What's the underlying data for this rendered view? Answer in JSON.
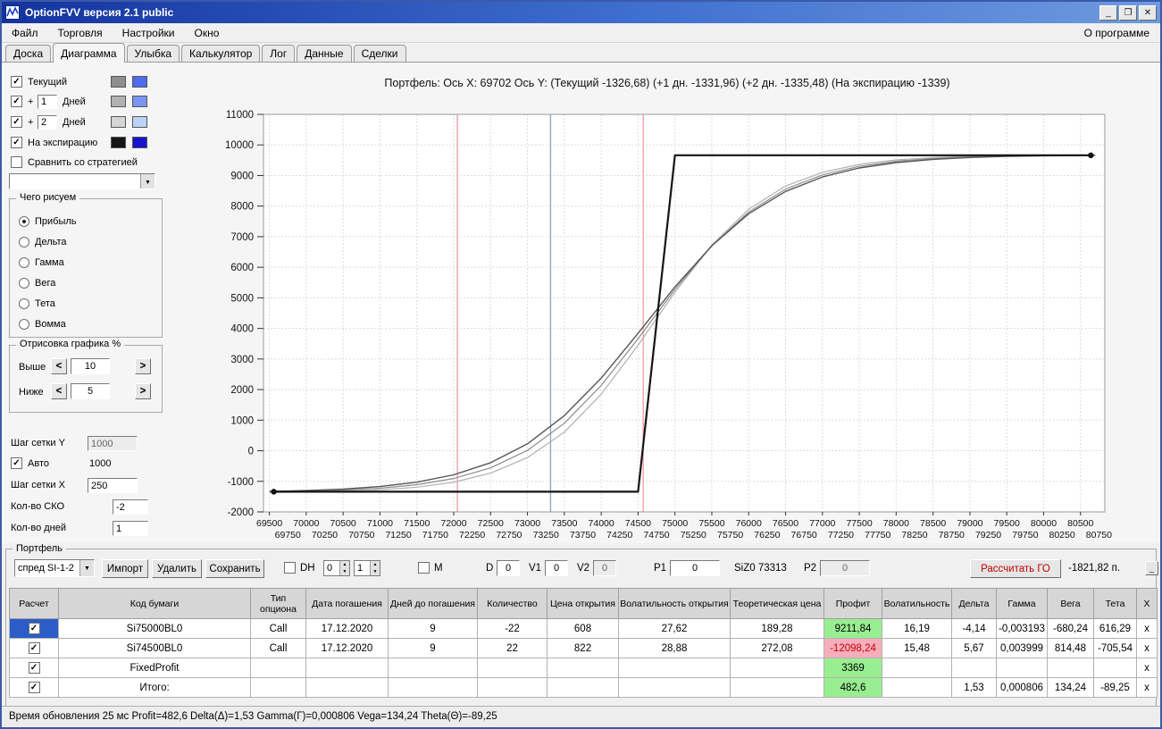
{
  "window": {
    "title": "OptionFVV версия 2.1 public",
    "controls": {
      "minimize": "_",
      "maximize": "❐",
      "close": "✕"
    }
  },
  "menu": {
    "items": [
      "Файл",
      "Торговля",
      "Настройки",
      "Окно"
    ],
    "right_item": "О программе"
  },
  "tabs": {
    "items": [
      "Доска",
      "Диаграмма",
      "Улыбка",
      "Калькулятор",
      "Лог",
      "Данные",
      "Сделки"
    ],
    "active": "Диаграмма"
  },
  "sidebar": {
    "toggles": [
      {
        "label": "Текущий",
        "checked": true,
        "colors": [
          "#8e8e8e",
          "#4f6bee"
        ]
      },
      {
        "prefix": "+",
        "value": "1",
        "label": "Дней",
        "checked": true,
        "colors": [
          "#b2b2b2",
          "#7b96f2"
        ]
      },
      {
        "prefix": "+",
        "value": "2",
        "label": "Дней",
        "checked": true,
        "colors": [
          "#d5d5d5",
          "#b9d2f8"
        ]
      },
      {
        "label": "На экспирацию",
        "checked": true,
        "colors": [
          "#151515",
          "#1515cd"
        ]
      }
    ],
    "compare": {
      "label": "Сравнить со стратегией",
      "checked": false
    },
    "strategy_select_value": "",
    "draw_group": {
      "title": "Чего рисуем",
      "options": [
        "Прибыль",
        "Дельта",
        "Гамма",
        "Вега",
        "Тета",
        "Вомма"
      ],
      "selected": "Прибыль"
    },
    "render_group": {
      "title": "Отрисовка графика %",
      "rows": [
        {
          "label": "Выше",
          "value": "10"
        },
        {
          "label": "Ниже",
          "value": "5"
        }
      ]
    },
    "fields": {
      "grid_y_label": "Шаг сетки Y",
      "grid_y_value": "1000",
      "auto_label": "Авто",
      "auto_checked": true,
      "auto_value": "1000",
      "grid_x_label": "Шаг сетки X",
      "grid_x_value": "250",
      "sko_label": "Кол-во СКО",
      "sko_value": "-2",
      "days_label": "Кол-во дней",
      "days_value": "1"
    }
  },
  "chart": {
    "title": "Портфель: Ось X: 69702 Ось Y:  (Текущий -1326,68)  (+1 дн. -1331,96)  (+2 дн. -1335,48)  (На экспирацию -1339)"
  },
  "chart_data": {
    "type": "line",
    "title": "Портфель: Ось X: 69702 Ось Y: (Текущий -1326,68) (+1 дн. -1331,96) (+2 дн. -1335,48) (На экспирацию -1339)",
    "xlabel": "",
    "ylabel": "",
    "x_range": [
      69420,
      80830
    ],
    "y_range": [
      -2000,
      11000
    ],
    "grid": true,
    "legend_position": "none",
    "y_ticks": [
      11000,
      10000,
      9000,
      8000,
      7000,
      6000,
      5000,
      4000,
      3000,
      2000,
      1000,
      0,
      -1000,
      -2000
    ],
    "x_ticks_upper": [
      69500,
      70000,
      70500,
      71000,
      71500,
      72000,
      72500,
      73000,
      73500,
      74000,
      74500,
      75000,
      75500,
      76000,
      76500,
      77000,
      77500,
      78000,
      78500,
      79000,
      79500,
      80000,
      80500
    ],
    "x_ticks_lower": [
      69750,
      70250,
      70750,
      71250,
      71750,
      72250,
      72750,
      73250,
      73750,
      74250,
      74750,
      75250,
      75750,
      76250,
      76750,
      77250,
      77750,
      78250,
      78750,
      79250,
      79750,
      80250,
      80750
    ],
    "vlines": [
      {
        "x": 72050,
        "color": "#f2a0ae",
        "meaning": "-2 СКО"
      },
      {
        "x": 73313,
        "color": "#96a5b6",
        "meaning": "SiZ0 73313"
      },
      {
        "x": 74570,
        "color": "#f2a0ae",
        "meaning": "+2 СКО"
      }
    ],
    "series": [
      {
        "name": "+2 дня",
        "color": "#b0b0b0",
        "width": 1.2,
        "points": [
          [
            69500,
            -1364
          ],
          [
            70000,
            -1350
          ],
          [
            70500,
            -1325
          ],
          [
            71000,
            -1278
          ],
          [
            71500,
            -1190
          ],
          [
            72000,
            -1029
          ],
          [
            72500,
            -733
          ],
          [
            73000,
            -225
          ],
          [
            73500,
            605
          ],
          [
            74000,
            1848
          ],
          [
            74500,
            3452
          ],
          [
            75000,
            5186
          ],
          [
            75500,
            6726
          ],
          [
            76000,
            7895
          ],
          [
            76500,
            8653
          ],
          [
            77000,
            9105
          ],
          [
            77500,
            9365
          ],
          [
            78000,
            9509
          ],
          [
            78500,
            9587
          ],
          [
            79000,
            9628
          ],
          [
            79500,
            9650
          ],
          [
            80000,
            9661
          ],
          [
            80500,
            9667
          ],
          [
            80700,
            9668
          ]
        ]
      },
      {
        "name": "+1 день",
        "color": "#8b8b8b",
        "width": 1.2,
        "points": [
          [
            69500,
            -1348
          ],
          [
            70000,
            -1327
          ],
          [
            70500,
            -1291
          ],
          [
            71000,
            -1225
          ],
          [
            71500,
            -1110
          ],
          [
            72000,
            -906
          ],
          [
            72500,
            -559
          ],
          [
            73000,
            14
          ],
          [
            73500,
            899
          ],
          [
            74000,
            2135
          ],
          [
            74500,
            3665
          ],
          [
            75000,
            5274
          ],
          [
            75500,
            6703
          ],
          [
            76000,
            7804
          ],
          [
            76500,
            8554
          ],
          [
            77000,
            9019
          ],
          [
            77500,
            9301
          ],
          [
            78000,
            9466
          ],
          [
            78500,
            9558
          ],
          [
            79000,
            9610
          ],
          [
            79500,
            9640
          ],
          [
            80000,
            9656
          ],
          [
            80500,
            9665
          ],
          [
            80700,
            9667
          ]
        ]
      },
      {
        "name": "Текущий",
        "color": "#555555",
        "width": 1.4,
        "points": [
          [
            69500,
            -1330
          ],
          [
            70000,
            -1302
          ],
          [
            70500,
            -1254
          ],
          [
            71000,
            -1169
          ],
          [
            71500,
            -1026
          ],
          [
            72000,
            -787
          ],
          [
            72500,
            -391
          ],
          [
            73000,
            225
          ],
          [
            73500,
            1147
          ],
          [
            74000,
            2374
          ],
          [
            74500,
            3840
          ],
          [
            75000,
            5360
          ],
          [
            75500,
            6702
          ],
          [
            76000,
            7748
          ],
          [
            76500,
            8480
          ],
          [
            77000,
            8953
          ],
          [
            77500,
            9246
          ],
          [
            78000,
            9423
          ],
          [
            78500,
            9527
          ],
          [
            79000,
            9588
          ],
          [
            79500,
            9624
          ],
          [
            80000,
            9644
          ],
          [
            80500,
            9656
          ],
          [
            80700,
            9660
          ]
        ]
      },
      {
        "name": "На экспирацию",
        "color": "#141414",
        "width": 2.2,
        "points": [
          [
            69560,
            -1339
          ],
          [
            74500,
            -1339
          ],
          [
            75000,
            9661
          ],
          [
            80640,
            9661
          ]
        ],
        "markers": [
          [
            69560,
            -1339
          ],
          [
            80640,
            9661
          ]
        ]
      }
    ]
  },
  "portfolio": {
    "group_title": "Портфель",
    "preset_value": "спред SI-1-2",
    "import_button": "Импорт",
    "delete_button": "Удалить",
    "save_button": "Сохранить",
    "dh_label": "DH",
    "dh_checked": false,
    "spinner1": "0",
    "spinner2": "1",
    "m_label": "M",
    "m_checked": false,
    "d_label": "D",
    "d_value": "0",
    "v1_label": "V1",
    "v1_value": "0",
    "v2_label": "V2",
    "v2_value": "0",
    "p1_label": "P1",
    "p1_value": "0",
    "ticker_label": "SiZ0 73313",
    "p2_label": "P2",
    "p2_value": "0",
    "calc_go_button": "Рассчитать ГО",
    "go_value": "-1821,82 п.",
    "collapse_button": "_",
    "table": {
      "headers": [
        "Расчет",
        "Код бумаги",
        "Тип опциона",
        "Дата погашения",
        "Дней до погашения",
        "Количество",
        "Цена открытия",
        "Волатильность открытия",
        "Теоретическая цена",
        "Профит",
        "Волатильность",
        "Дельта",
        "Гамма",
        "Вега",
        "Тета",
        "X"
      ],
      "rows": [
        {
          "checked": true,
          "selected": true,
          "delete_label": "x",
          "values": [
            "Si75000BL0",
            "Call",
            "17.12.2020",
            "9",
            "-22",
            "608",
            "27,62",
            "189,28",
            "9211,84",
            "16,19",
            "-4,14",
            "-0,003193",
            "-680,24",
            "616,29"
          ],
          "profit_bg": "#98ee90",
          "profit_fg": "#000000"
        },
        {
          "checked": true,
          "selected": false,
          "delete_label": "x",
          "values": [
            "Si74500BL0",
            "Call",
            "17.12.2020",
            "9",
            "22",
            "822",
            "28,88",
            "272,08",
            "-12098,24",
            "15,48",
            "5,67",
            "0,003999",
            "814,48",
            "-705,54"
          ],
          "profit_bg": "#f6aebc",
          "profit_fg": "#cc0000"
        },
        {
          "checked": true,
          "selected": false,
          "delete_label": "x",
          "values": [
            "FixedProfit",
            "",
            "",
            "",
            "",
            "",
            "",
            "",
            "3369",
            "",
            "",
            "",
            "",
            ""
          ],
          "profit_bg": "#98ee90",
          "profit_fg": "#000000"
        },
        {
          "checked": true,
          "selected": false,
          "delete_label": "x",
          "values": [
            "Итого:",
            "",
            "",
            "",
            "",
            "",
            "",
            "",
            "482,6",
            "",
            "1,53",
            "0,000806",
            "134,24",
            "-89,25"
          ],
          "profit_bg": "#98ee90",
          "profit_fg": "#000000"
        }
      ]
    }
  },
  "statusbar": {
    "text": "Время обновления 25 мс  Profit=482,6 Delta(Δ)=1,53 Gamma(Г)=0,000806 Vega=134,24 Theta(Θ)=-89,25"
  }
}
